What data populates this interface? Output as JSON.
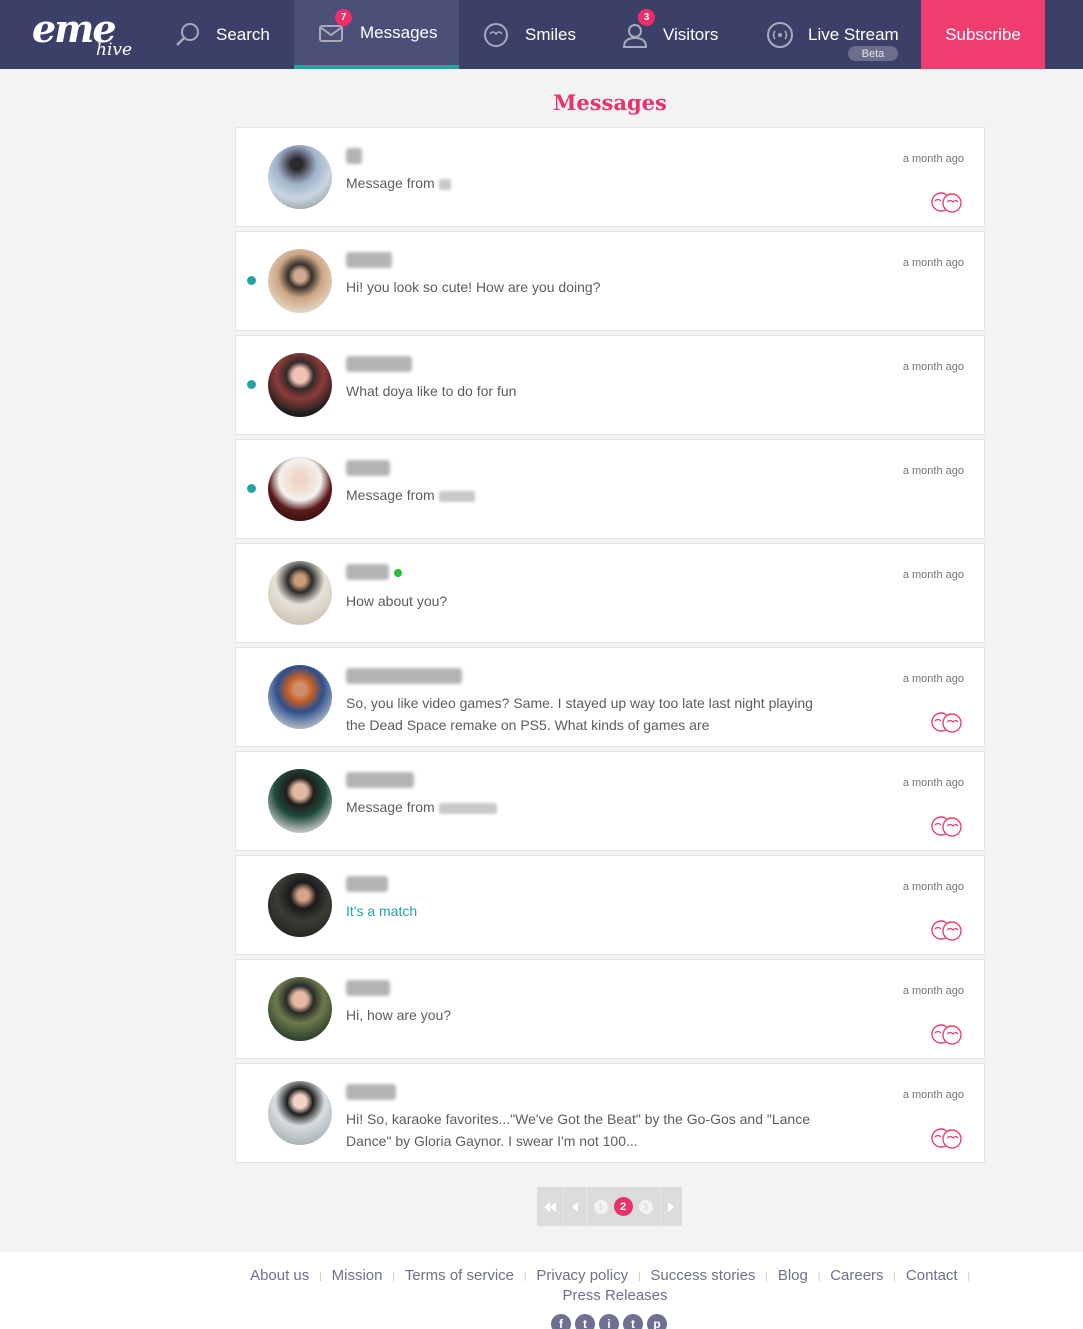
{
  "nav": {
    "logo_main": "eme",
    "logo_sub": "hive",
    "items": [
      {
        "label": "Search",
        "icon": "search-icon"
      },
      {
        "label": "Messages",
        "icon": "envelope-icon",
        "badge": "7"
      },
      {
        "label": "Smiles",
        "icon": "smile-icon"
      },
      {
        "label": "Visitors",
        "icon": "user-icon",
        "badge": "3"
      },
      {
        "label": "Live Stream",
        "icon": "broadcast-icon",
        "tag": "Beta"
      }
    ],
    "subscribe": "Subscribe"
  },
  "page_title": "Messages",
  "messages": [
    {
      "text": "Message from",
      "time": "a month ago",
      "unread": false,
      "smile": true,
      "match": false
    },
    {
      "text": "Hi! you look so cute! How are you doing?",
      "time": "a month ago",
      "unread": true,
      "smile": false,
      "match": false
    },
    {
      "text": "What doya like to do for fun",
      "time": "a month ago",
      "unread": true,
      "smile": false,
      "match": false
    },
    {
      "text": "Message from",
      "time": "a month ago",
      "unread": true,
      "smile": false,
      "match": false
    },
    {
      "text": "How about you?",
      "time": "a month ago",
      "unread": false,
      "smile": false,
      "match": false,
      "online": true
    },
    {
      "text": "So, you like video games? Same. I stayed up way too late last night playing the Dead Space remake on PS5. What kinds of games are",
      "time": "a month ago",
      "unread": false,
      "smile": true,
      "match": false
    },
    {
      "text": "Message from",
      "time": "a month ago",
      "unread": false,
      "smile": true,
      "match": false
    },
    {
      "text": "It's a match",
      "time": "a month ago",
      "unread": false,
      "smile": true,
      "match": true
    },
    {
      "text": "Hi, how are you?",
      "time": "a month ago",
      "unread": false,
      "smile": true,
      "match": false
    },
    {
      "text": "Hi! So, karaoke favorites...\"We've Got the Beat\" by the Go-Gos and \"Lance Dance\" by Gloria Gaynor. I swear I'm not 100...",
      "time": "a month ago",
      "unread": false,
      "smile": true,
      "match": false
    }
  ],
  "pagination": {
    "pages": [
      "1",
      "2",
      "3"
    ],
    "current": "2"
  },
  "footer": {
    "links": [
      "About us",
      "Mission",
      "Terms of service",
      "Privacy policy",
      "Success stories",
      "Blog",
      "Careers",
      "Contact",
      "Press Releases"
    ],
    "social": [
      "f",
      "t",
      "i",
      "t",
      "p"
    ]
  },
  "colors": {
    "nav": "#3b4069",
    "accent": "#e8336a",
    "teal": "#26a3a3"
  }
}
